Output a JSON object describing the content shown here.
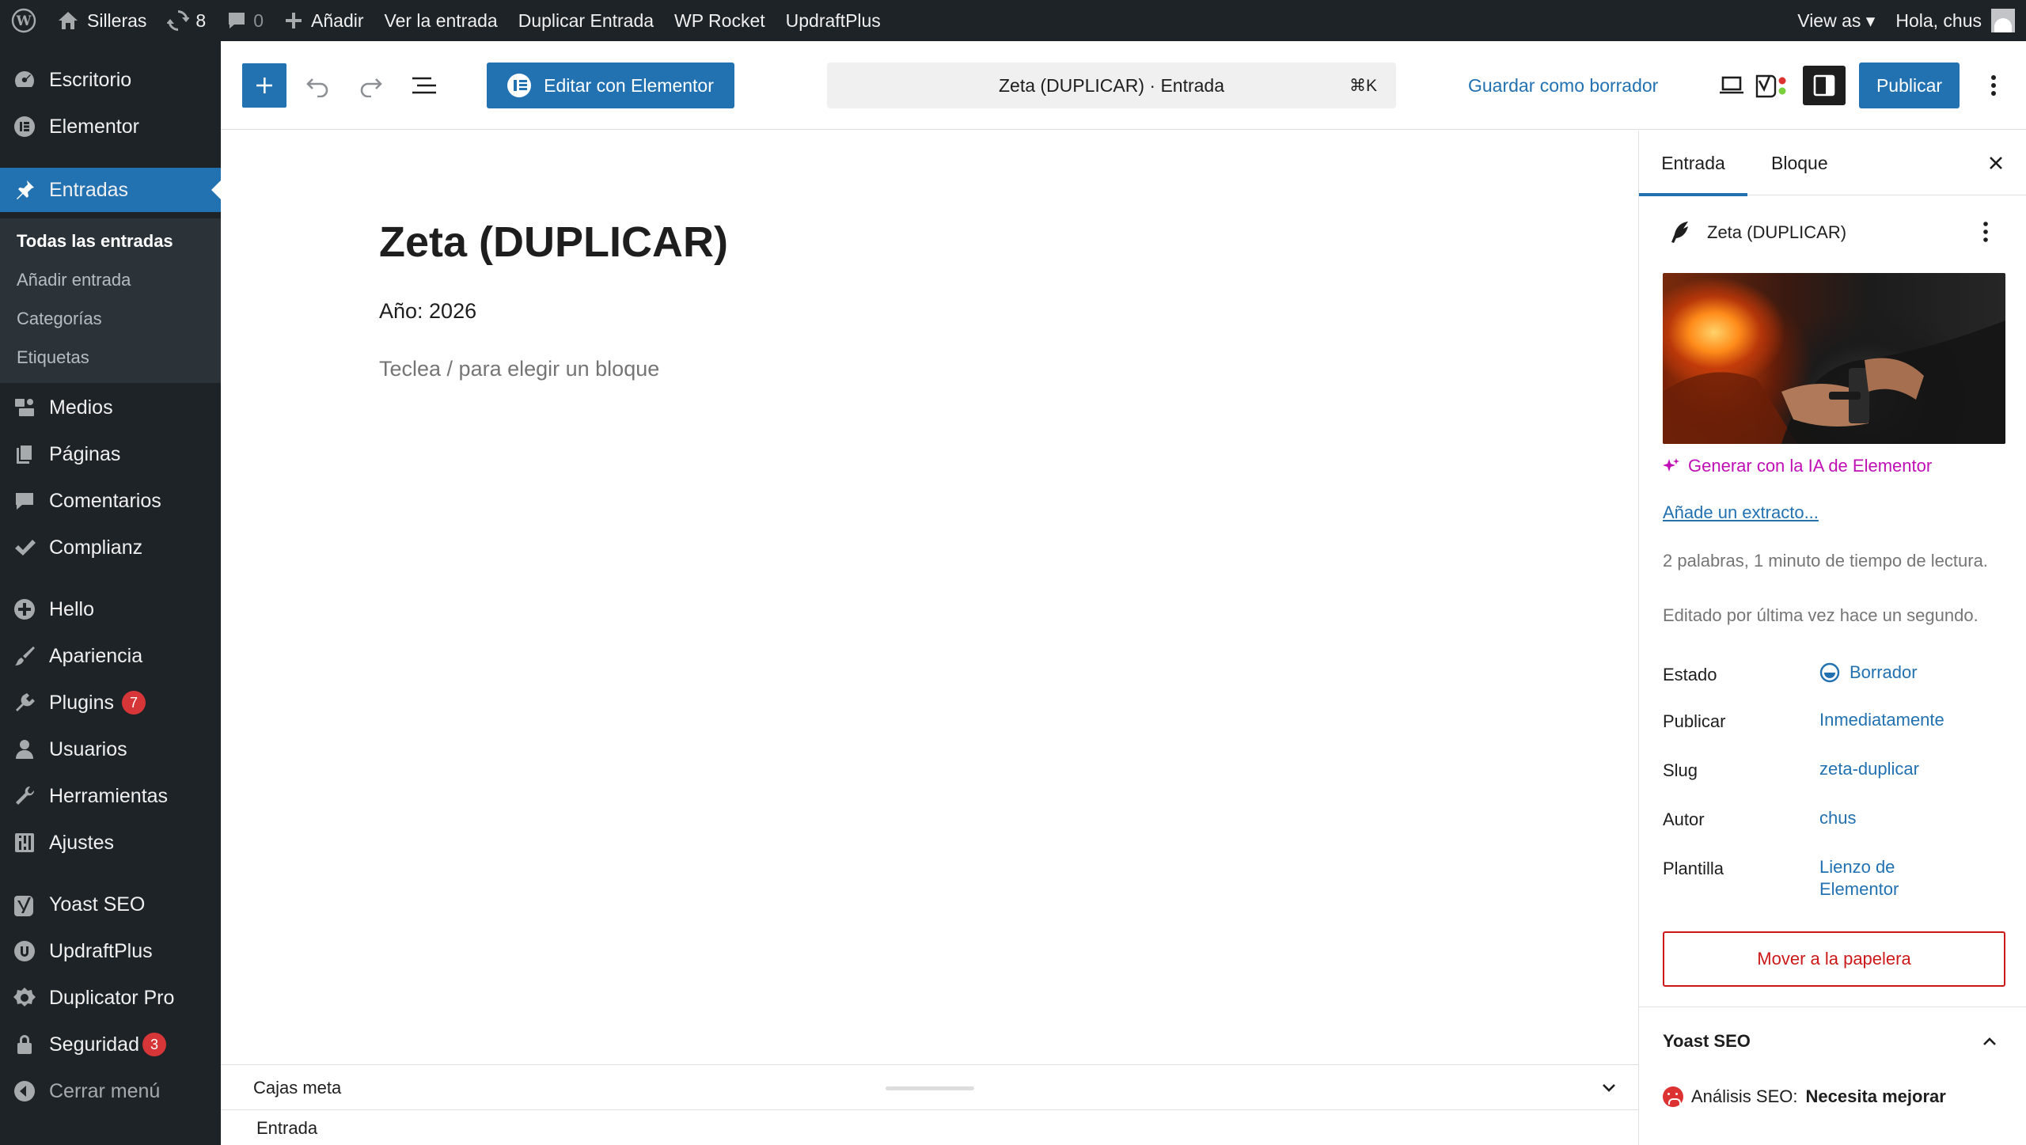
{
  "admin_bar": {
    "site_name": "Silleras",
    "updates_count": "8",
    "comments_count": "0",
    "add_new": "Añadir",
    "view_post": "Ver la entrada",
    "duplicate_post": "Duplicar Entrada",
    "wp_rocket": "WP Rocket",
    "updraftplus": "UpdraftPlus",
    "view_as": "View as ▾",
    "greeting": "Hola, chus"
  },
  "sidebar": {
    "items": [
      {
        "label": "Escritorio",
        "icon": "dashboard-icon"
      },
      {
        "label": "Elementor",
        "icon": "elementor-icon"
      },
      {
        "label": "Entradas",
        "icon": "pin-icon"
      },
      {
        "label": "Medios",
        "icon": "media-icon"
      },
      {
        "label": "Páginas",
        "icon": "pages-icon"
      },
      {
        "label": "Comentarios",
        "icon": "comments-icon"
      },
      {
        "label": "Complianz",
        "icon": "checkmark-icon"
      },
      {
        "label": "Hello",
        "icon": "plus-circle-icon"
      },
      {
        "label": "Apariencia",
        "icon": "brush-icon"
      },
      {
        "label": "Plugins",
        "icon": "plugin-icon",
        "badge": "7"
      },
      {
        "label": "Usuarios",
        "icon": "user-icon"
      },
      {
        "label": "Herramientas",
        "icon": "wrench-icon"
      },
      {
        "label": "Ajustes",
        "icon": "settings-icon"
      },
      {
        "label": "Yoast SEO",
        "icon": "yoast-icon"
      },
      {
        "label": "UpdraftPlus",
        "icon": "updraft-icon"
      },
      {
        "label": "Duplicator Pro",
        "icon": "duplicator-icon"
      },
      {
        "label": "Seguridad",
        "icon": "lock-icon",
        "badge": "3"
      },
      {
        "label": "Cerrar menú",
        "icon": "collapse-icon"
      }
    ],
    "submenu": [
      "Todas las entradas",
      "Añadir entrada",
      "Categorías",
      "Etiquetas"
    ]
  },
  "header": {
    "elementor_button": "Editar con Elementor",
    "doc_title": "Zeta (DUPLICAR) · Entrada",
    "shortcut": "⌘K",
    "save_draft": "Guardar como borrador",
    "publish": "Publicar"
  },
  "canvas": {
    "title": "Zeta (DUPLICAR)",
    "paragraph": "Año: 2026",
    "placeholder": "Teclea / para elegir un bloque"
  },
  "meta": {
    "title": "Cajas meta",
    "breadcrumb": "Entrada"
  },
  "inspector": {
    "tabs": [
      "Entrada",
      "Bloque"
    ],
    "post_title": "Zeta (DUPLICAR)",
    "ai_link": "Generar con la IA de Elementor",
    "excerpt_link": "Añade un extracto...",
    "word_count": "2 palabras, 1 minuto de tiempo de lectura.",
    "last_edited": "Editado por última vez hace un segundo.",
    "rows": [
      {
        "label": "Estado",
        "value": "Borrador"
      },
      {
        "label": "Publicar",
        "value": "Inmediatamente"
      },
      {
        "label": "Slug",
        "value": "zeta-duplicar"
      },
      {
        "label": "Autor",
        "value": "chus"
      },
      {
        "label": "Plantilla",
        "value": "Lienzo de Elementor"
      }
    ],
    "trash": "Mover a la papelera",
    "yoast_title": "Yoast SEO",
    "seo_label": "Análisis SEO:",
    "seo_value": "Necesita mejorar"
  },
  "colors": {
    "admin_dark": "#1d2327",
    "accent": "#2271b1",
    "danger": "#cc1818",
    "ai_purple": "#c00fb5"
  }
}
